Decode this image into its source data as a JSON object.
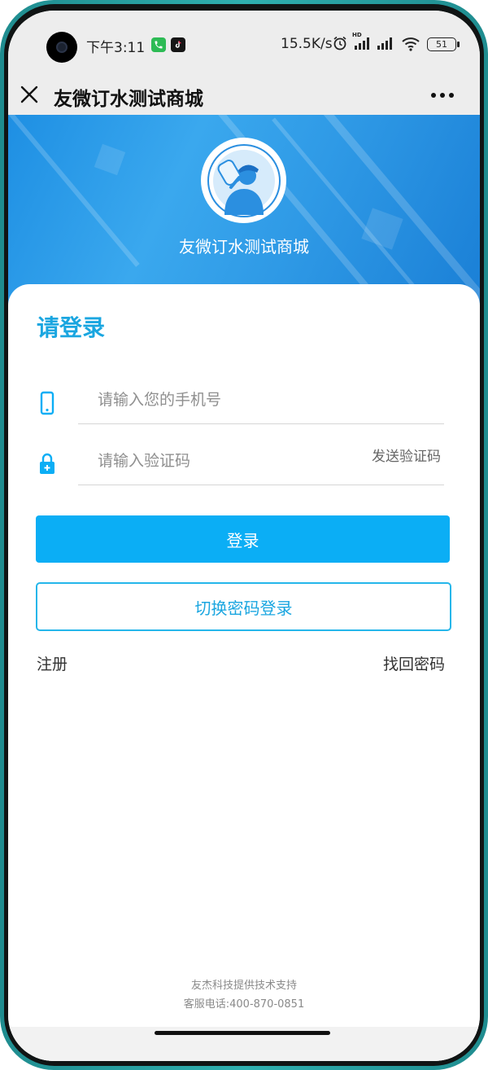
{
  "status_bar": {
    "time": "下午3:11",
    "network_speed": "15.5K/s",
    "hd_label": "HD",
    "battery": "51",
    "icons": [
      "phone-app-icon",
      "tiktok-app-icon",
      "alarm-icon",
      "signal-hd-icon",
      "signal-icon",
      "wifi-icon",
      "battery-icon"
    ]
  },
  "navbar": {
    "title": "友微订水测试商城",
    "close_icon": "close-icon",
    "more_icon": "more-dots-icon"
  },
  "hero": {
    "shop_name": "友微订水测试商城",
    "logo_icon": "water-delivery-man-icon"
  },
  "login": {
    "heading": "请登录",
    "phone": {
      "value": "",
      "placeholder": "请输入您的手机号",
      "icon": "phone-icon"
    },
    "code": {
      "value": "",
      "placeholder": "请输入验证码",
      "icon": "lock-icon",
      "send_label": "发送验证码"
    },
    "login_button": "登录",
    "switch_button": "切换密码登录",
    "register_link": "注册",
    "forgot_link": "找回密码"
  },
  "footer": {
    "support": "友杰科技提供技术支持",
    "hotline": "客服电话:400-870-0851"
  },
  "colors": {
    "accent": "#0baef5",
    "heading": "#1aa6e0",
    "banner": "#2f9ae6",
    "phone_frame": "#1f8c8f"
  }
}
